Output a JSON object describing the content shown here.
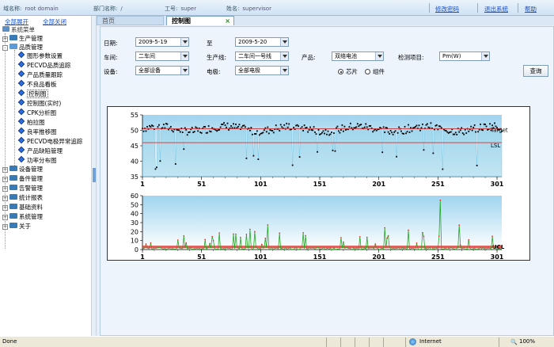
{
  "topbar": {
    "domain_label": "域名称:",
    "domain_value": "root domain",
    "dept_label": "部门名称:",
    "dept_value": "/",
    "emp_label": "工号:",
    "emp_value": "super",
    "name_label": "姓名:",
    "name_value": "supervisor",
    "change_password": "修改密码",
    "logout": "退出系统",
    "help": "帮助"
  },
  "sidebar": {
    "expand_all": "全部展开",
    "collapse_all": "全部关闭",
    "menu_title": "系统菜单",
    "groups": [
      {
        "label": "生产管理",
        "expanded": false
      },
      {
        "label": "品质管理",
        "expanded": true
      },
      {
        "label": "设备管理",
        "expanded": false
      },
      {
        "label": "备件管理",
        "expanded": false
      },
      {
        "label": "告警管理",
        "expanded": false
      },
      {
        "label": "统计报表",
        "expanded": false
      },
      {
        "label": "基础资料",
        "expanded": false
      },
      {
        "label": "系统管理",
        "expanded": false
      },
      {
        "label": "关于",
        "expanded": false
      }
    ],
    "quality_items": [
      "图形参数设置",
      "PECVD品质追踪",
      "产品质量跟踪",
      "不良品看板",
      "控制图",
      "控制图(实时)",
      "CPK分析图",
      "柏拉图",
      "良率推移图",
      "PECVD电极异常追踪",
      "产品缺陷管理",
      "功率分布图"
    ],
    "selected_item": "控制图"
  },
  "tabs": [
    {
      "label": "首页",
      "active": false
    },
    {
      "label": "控制图",
      "active": true
    }
  ],
  "filters": {
    "date_label": "日期:",
    "date_from": "2009-5-19",
    "to_label": "至",
    "date_to": "2009-5-20",
    "workshop_label": "车间:",
    "workshop": "二车间",
    "line_label": "生产线:",
    "line": "二车间一号线",
    "product_label": "产品:",
    "product": "双络电池",
    "inspect_label": "检测项目:",
    "inspect": "Pm(W)",
    "device_label": "设备:",
    "device": "全部设备",
    "electrode_label": "电极:",
    "electrode": "全部电极",
    "radio_chip": "芯片",
    "radio_group": "组件",
    "radio_selected": "芯片",
    "query_button": "查询"
  },
  "chart_data": [
    {
      "type": "line",
      "title": "",
      "ylim": [
        35,
        55
      ],
      "yticks": [
        35,
        40,
        45,
        50,
        55
      ],
      "xticks": [
        1,
        51,
        101,
        151,
        201,
        251,
        301
      ],
      "xlim": [
        1,
        305
      ],
      "reference_lines": [
        {
          "name": "Target",
          "value": 50.5,
          "color": "#cc3333"
        },
        {
          "name": "LSL",
          "value": 46,
          "color": "#cc3333"
        }
      ],
      "series_color": "#8fd0e8",
      "marker_color": "#000000"
    },
    {
      "type": "line",
      "title": "",
      "ylim": [
        0,
        60
      ],
      "yticks": [
        0,
        10,
        20,
        30,
        40,
        50,
        60
      ],
      "xticks": [
        1,
        51,
        101,
        151,
        201,
        251,
        301
      ],
      "xlim": [
        1,
        305
      ],
      "reference_lines": [
        {
          "name": "UCL",
          "value": 3,
          "color": "#dd2222"
        }
      ],
      "series_color": "#22aa22",
      "marker_color": "#dd2222"
    }
  ],
  "statusbar": {
    "left": "Done",
    "zone": "Internet",
    "zoom": "100%"
  }
}
